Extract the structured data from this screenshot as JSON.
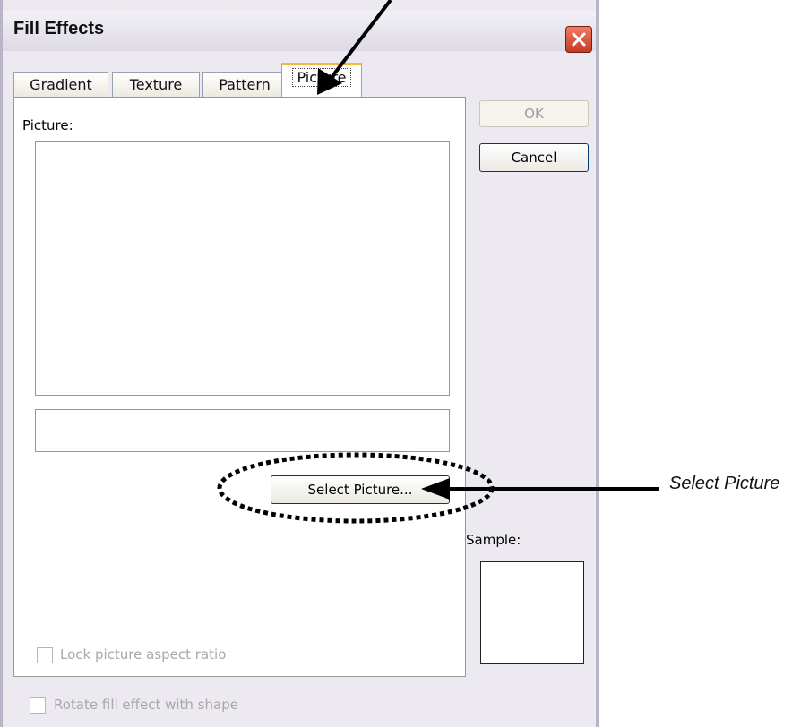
{
  "dialog": {
    "title": "Fill Effects",
    "close_icon": "close-icon",
    "tabs": [
      {
        "label": "Gradient",
        "active": false
      },
      {
        "label": "Texture",
        "active": false
      },
      {
        "label": "Pattern",
        "active": false
      },
      {
        "label": "Picture",
        "active": true
      }
    ],
    "picture_label": "Picture:",
    "select_picture_label": "Select Picture...",
    "lock_aspect_label": "Lock picture aspect ratio",
    "rotate_label": "Rotate fill effect with shape",
    "ok_label": "OK",
    "cancel_label": "Cancel",
    "sample_label": "Sample:"
  },
  "annotation": {
    "label": "Select Picture"
  },
  "colors": {
    "dialog_bg": "#ece9f0",
    "close_red": "#c43d22",
    "active_tab_accent": "#f5b83d",
    "button_border": "#003c74"
  }
}
